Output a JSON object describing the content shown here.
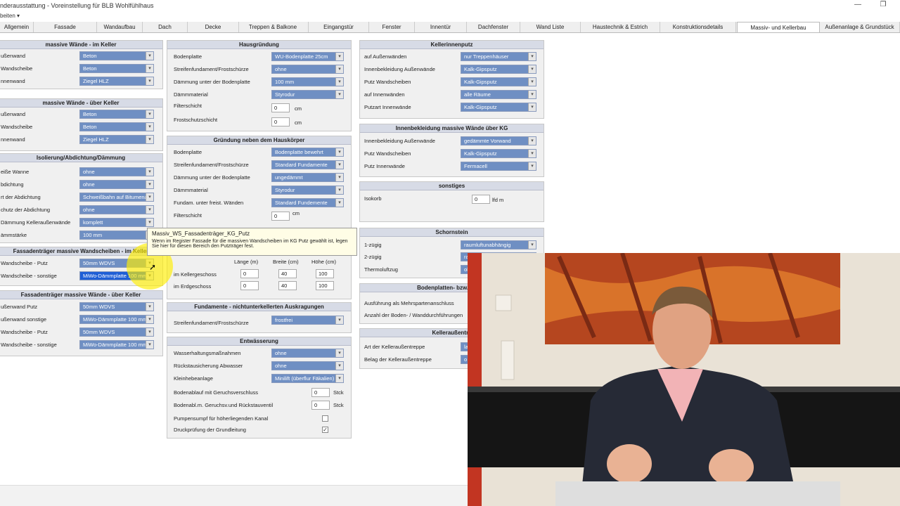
{
  "window": {
    "title": "nderausstattung - Voreinstellung für BLB Wohlfühlhaus",
    "min_icon": "minimize-icon",
    "restore_icon": "restore-icon"
  },
  "menu": {
    "label": "beiten ▾"
  },
  "tabs": [
    {
      "label": "Allgemein"
    },
    {
      "label": "Fassade"
    },
    {
      "label": "Wandaufbau"
    },
    {
      "label": "Dach"
    },
    {
      "label": "Decke"
    },
    {
      "label": "Treppen & Balkone"
    },
    {
      "label": "Eingangstür"
    },
    {
      "label": "Fenster"
    },
    {
      "label": "Innentür"
    },
    {
      "label": "Dachfenster"
    },
    {
      "label": "Wand Liste"
    },
    {
      "label": "Haustechnik & Estrich"
    },
    {
      "label": "Konstruktionsdetails"
    },
    {
      "label": "Massiv- und Kellerbau",
      "active": true
    },
    {
      "label": "Außenanlage & Grundstück"
    }
  ],
  "col1": {
    "p1": {
      "title": "massive Wände - im Keller",
      "rows": [
        {
          "label": "ußenwand",
          "value": "Beton"
        },
        {
          "label": "Wandscheibe",
          "value": "Beton"
        },
        {
          "label": "nnenwand",
          "value": "Ziegel HLZ"
        }
      ]
    },
    "p2": {
      "title": "massive Wände - über Keller",
      "rows": [
        {
          "label": "ußenwand",
          "value": "Beton"
        },
        {
          "label": "Wandscheibe",
          "value": "Beton"
        },
        {
          "label": "nnenwand",
          "value": "Ziegel HLZ"
        }
      ]
    },
    "p3": {
      "title": "Isolierung/Abdichtung/Dämmung",
      "rows": [
        {
          "label": "eiße Wanne",
          "value": "ohne"
        },
        {
          "label": "bdichtung",
          "value": "ohne"
        },
        {
          "label": "rt der Abdichtung",
          "value": "Schweißbahn auf Bitumena"
        },
        {
          "label": "chutz der Abdichtung",
          "value": "ohne"
        },
        {
          "label": "Dämmung Kelleraußenwände",
          "value": "komplett"
        },
        {
          "label": "ämmstärke",
          "value": "100 mm"
        }
      ]
    },
    "p4": {
      "title": "Fassadenträger massive Wandscheiben - im Keller",
      "rows": [
        {
          "label": "Wandscheibe - Putz",
          "value": "50mm WDVS"
        },
        {
          "label": "Wandscheibe - sonstige",
          "value": "MiWo-Dämmplatte 100 mm"
        }
      ]
    },
    "p5": {
      "title": "Fassadenträger massive Wände - über Keller",
      "rows": [
        {
          "label": "ußenwand Putz",
          "value": "50mm WDVS"
        },
        {
          "label": "ußenwand sonstige",
          "value": "MiWo-Dämmplatte 100 mm"
        },
        {
          "label": "Wandscheibe - Putz",
          "value": "50mm WDVS"
        },
        {
          "label": "Wandscheibe - sonstige",
          "value": "MiWo-Dämmplatte 100 mm"
        }
      ]
    }
  },
  "col2": {
    "hg": {
      "title": "Hausgründung",
      "rows": [
        {
          "label": "Bodenplatte",
          "value": "WU-Bodenplatte 25cm"
        },
        {
          "label": "Streifenfundament/Frostschürze",
          "value": "ohne"
        },
        {
          "label": "Dämmung unter der Bodenplatte",
          "value": "100 mm"
        },
        {
          "label": "Dämmmaterial",
          "value": "Styrodur"
        }
      ],
      "nums": [
        {
          "label": "Filterschicht",
          "value": "0",
          "unit": "cm"
        },
        {
          "label": "Frostschutzschicht",
          "value": "0",
          "unit": "cm"
        }
      ]
    },
    "gn": {
      "title": "Gründung neben dem Hauskörper",
      "rows": [
        {
          "label": "Bodenplatte",
          "value": "Bodenplatte bewehrt"
        },
        {
          "label": "Streifenfundament/Frostschürze",
          "value": "Standard Fundamente"
        },
        {
          "label": "Dämmung unter der Bodenplatte",
          "value": "ungedämmt"
        },
        {
          "label": "Dämmmaterial",
          "value": "Styrodur"
        },
        {
          "label": "Fundam. unter freist. Wänden",
          "value": "Standard Fundemente"
        }
      ],
      "filter_label": "Filterschicht",
      "filter_value": "0",
      "filter_unit": "cm"
    },
    "dim": {
      "headers": [
        "Länge (m)",
        "Breite (cm)",
        "Höhe (cm)"
      ],
      "rows": [
        {
          "label": "im Kellergeschoss",
          "values": [
            "0",
            "40",
            "100"
          ]
        },
        {
          "label": "im Erdgeschoss",
          "values": [
            "0",
            "40",
            "100"
          ]
        }
      ]
    },
    "fa": {
      "title": "Fundamente - nichtunterkellerten Auskragungen",
      "label": "Streifenfundament/Frostschürze",
      "value": "frostfrei"
    },
    "ent": {
      "title": "Entwässerung",
      "rows": [
        {
          "label": "Wasserhaltungsmaßnahmen",
          "value": "ohne"
        },
        {
          "label": "Rückstausicherung Abwasser",
          "value": "ohne"
        },
        {
          "label": "Kleinhebeanlage",
          "value": "Minilift (überflur Fäkalien)"
        }
      ],
      "nums": [
        {
          "label": "Bodenablauf mit Geruchsverschluss",
          "value": "0",
          "unit": "Stck"
        },
        {
          "label": "Bodenabl.m. Geruchsv.und Rückstauventil",
          "value": "0",
          "unit": "Stck"
        }
      ],
      "checks": [
        {
          "label": "Pumpensumpf für höherliegenden Kanal",
          "checked": false
        },
        {
          "label": "Druckprüfung der Grundleitung",
          "checked": true
        }
      ]
    }
  },
  "col3": {
    "kp": {
      "title": "Kellerinnenputz",
      "rows": [
        {
          "label": "auf Außenwänden",
          "value": "nur Treppenhäuser"
        },
        {
          "label": "Innenbekleidung Außenwände",
          "value": "Kalk-Gipsputz"
        },
        {
          "label": "Putz Wandscheiben",
          "value": "Kalk-Gipsputz"
        },
        {
          "label": "auf Innenwänden",
          "value": "alle Räume"
        },
        {
          "label": "Putzart Innenwände",
          "value": "Kalk-Gipsputz"
        }
      ]
    },
    "ib": {
      "title": "Innenbekleidung massive Wände über KG",
      "rows": [
        {
          "label": "Innenbekleidung Außenwände",
          "value": "gedämmte Vorwand"
        },
        {
          "label": "Putz Wandscheiben",
          "value": "Kalk-Gipsputz"
        },
        {
          "label": "Putz Innenwände",
          "value": "Fermacell"
        }
      ]
    },
    "so": {
      "title": "sonstiges",
      "label": "Isokorb",
      "value": "0",
      "unit": "lfd m"
    },
    "sch": {
      "title": "Schornstein",
      "rows": [
        {
          "label": "1-zügig",
          "value": "raumluftunabhängig"
        },
        {
          "label": "2-zügig",
          "value": "ra"
        },
        {
          "label": "Thermoluftzug",
          "value": "ol"
        }
      ]
    },
    "bp": {
      "title": "Bodenplatten- bzw. Mauer",
      "rows": [
        {
          "label": "Ausführung als Mehrspartenanschluss"
        },
        {
          "label": "Anzahl der Boden- / Wanddurchführungen"
        }
      ]
    },
    "kt": {
      "title": "Kelleraußentre",
      "rows": [
        {
          "label": "Art der Kelleraußentreppe",
          "value": "la"
        },
        {
          "label": "Belag der Kelleraußentreppe",
          "value": "o"
        }
      ]
    }
  },
  "tooltip": {
    "title": "Massiv_WS_Fassadenträger_KG_Putz",
    "text": "Wenn im Register Fassade für die massiven Wandscheiben im KG Putz gewählt ist, legen Sie hier für diesen Bereich den Putzträger fest."
  },
  "video": {
    "description_icon": "presenter-video-icon"
  }
}
